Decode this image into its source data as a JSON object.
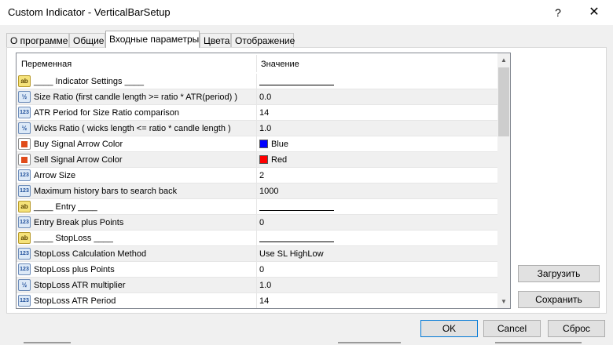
{
  "window": {
    "title": "Custom Indicator - VerticalBarSetup",
    "help_label": "?",
    "close_label": "✕"
  },
  "tabs": [
    {
      "label": "О программе",
      "active": false
    },
    {
      "label": "Общие",
      "active": false
    },
    {
      "label": "Входные параметры",
      "active": true
    },
    {
      "label": "Цвета",
      "active": false
    },
    {
      "label": "Отображение",
      "active": false
    }
  ],
  "grid": {
    "headers": {
      "variable": "Переменная",
      "value": "Значение"
    },
    "rows": [
      {
        "icon": "ab-icon",
        "icon_text": "ab",
        "name": "____ Indicator Settings ____",
        "value": "",
        "underline": true
      },
      {
        "icon": "fraction-icon",
        "icon_text": "½",
        "name": "Size Ratio (first candle length >= ratio * ATR(period) )",
        "value": "0.0"
      },
      {
        "icon": "number-icon",
        "icon_text": "123",
        "name": "ATR Period for Size Ratio comparison",
        "value": "14"
      },
      {
        "icon": "fraction-icon",
        "icon_text": "½",
        "name": "Wicks Ratio ( wicks length <= ratio * candle length )",
        "value": "1.0"
      },
      {
        "icon": "color-icon",
        "name": "Buy Signal Arrow Color",
        "value": "Blue",
        "swatch": "#0000ff"
      },
      {
        "icon": "color-icon",
        "name": "Sell Signal Arrow Color",
        "value": "Red",
        "swatch": "#ff0000"
      },
      {
        "icon": "number-icon",
        "icon_text": "123",
        "name": "Arrow Size",
        "value": "2"
      },
      {
        "icon": "number-icon",
        "icon_text": "123",
        "name": "Maximum history bars to search back",
        "value": "1000"
      },
      {
        "icon": "ab-icon",
        "icon_text": "ab",
        "name": "____ Entry ____",
        "value": "",
        "underline": true
      },
      {
        "icon": "number-icon",
        "icon_text": "123",
        "name": "Entry Break plus Points",
        "value": "0"
      },
      {
        "icon": "ab-icon",
        "icon_text": "ab",
        "name": "____ StopLoss ____",
        "value": "",
        "underline": true
      },
      {
        "icon": "number-icon",
        "icon_text": "123",
        "name": "StopLoss Calculation Method",
        "value": "Use SL HighLow"
      },
      {
        "icon": "number-icon",
        "icon_text": "123",
        "name": "StopLoss plus Points",
        "value": "0"
      },
      {
        "icon": "fraction-icon",
        "icon_text": "½",
        "name": "StopLoss ATR multiplier",
        "value": "1.0"
      },
      {
        "icon": "number-icon",
        "icon_text": "123",
        "name": "StopLoss ATR Period",
        "value": "14"
      }
    ]
  },
  "side_buttons": {
    "load": "Загрузить",
    "save": "Сохранить"
  },
  "footer_buttons": {
    "ok": "OK",
    "cancel": "Cancel",
    "reset": "Сброс"
  },
  "colors": {
    "accent": "#0078d7",
    "buy": "#0000ff",
    "sell": "#ff0000"
  }
}
